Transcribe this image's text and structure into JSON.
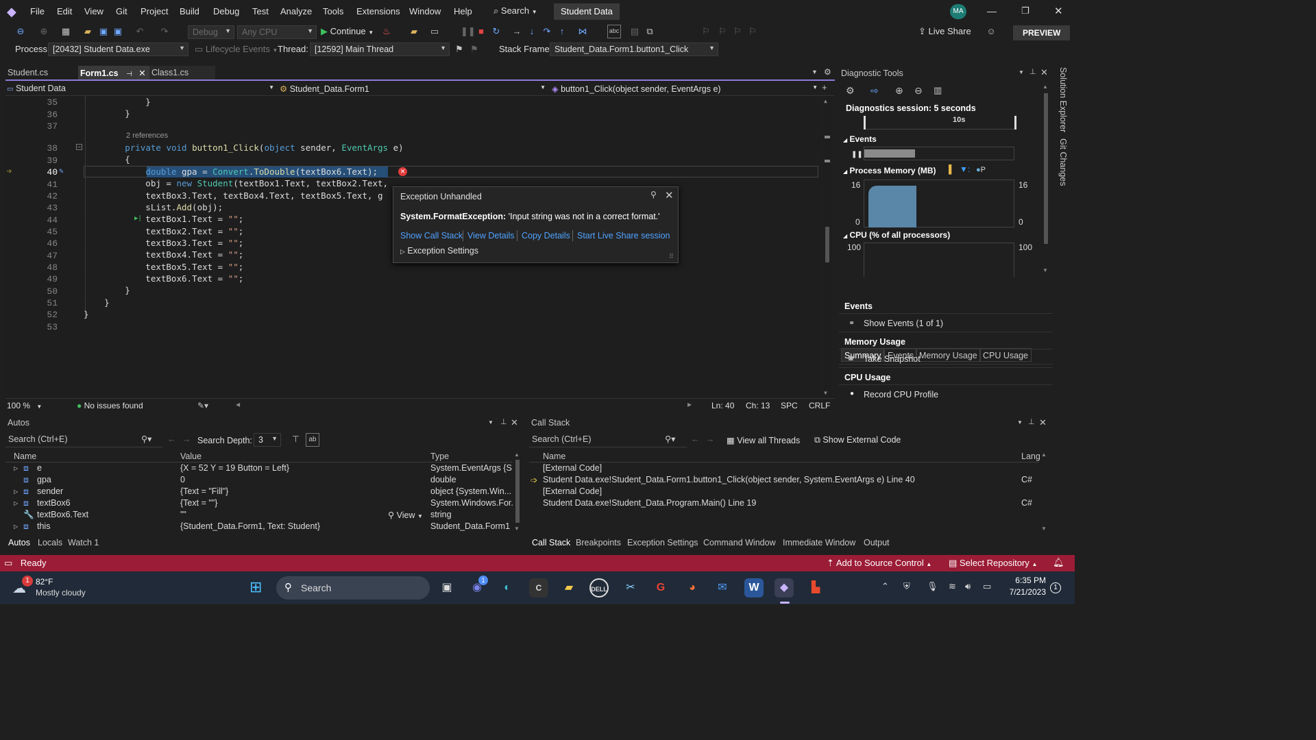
{
  "menu": {
    "items": [
      "File",
      "Edit",
      "View",
      "Git",
      "Project",
      "Build",
      "Debug",
      "Test",
      "Analyze",
      "Tools",
      "Extensions",
      "Window",
      "Help"
    ],
    "search_label": "Search",
    "solution_name": "Student Data",
    "avatar": "MA",
    "preview_label": "PREVIEW",
    "live_share_label": "Live Share"
  },
  "toolbar": {
    "config": "Debug",
    "platform": "Any CPU",
    "continue_label": "Continue"
  },
  "debugbar": {
    "process_label": "Process:",
    "process_value": "[20432] Student Data.exe",
    "lifecycle_label": "Lifecycle Events",
    "thread_label": "Thread:",
    "thread_value": "[12592] Main Thread",
    "stackframe_label": "Stack Frame:",
    "stackframe_value": "Student_Data.Form1.button1_Click"
  },
  "tabs": [
    "Student.cs",
    "Form1.cs",
    "Class1.cs"
  ],
  "navbar": {
    "project": "Student Data",
    "class": "Student_Data.Form1",
    "member": "button1_Click(object sender, EventArgs e)"
  },
  "editor": {
    "references": "2 references",
    "lines": [
      {
        "n": "35",
        "t": "            }"
      },
      {
        "n": "36",
        "t": "        }"
      },
      {
        "n": "37",
        "t": ""
      },
      {
        "n": "38",
        "t": "        private void button1_Click(object sender, EventArgs e)"
      },
      {
        "n": "39",
        "t": "        {"
      },
      {
        "n": "40",
        "t": "            double gpa = Convert.ToDouble(textBox6.Text);"
      },
      {
        "n": "41",
        "t": "            obj = new Student(textBox1.Text, textBox2.Text,"
      },
      {
        "n": "42",
        "t": "            textBox3.Text, textBox4.Text, textBox5.Text, g"
      },
      {
        "n": "43",
        "t": "            sList.Add(obj);"
      },
      {
        "n": "44",
        "t": "            textBox1.Text = \"\";"
      },
      {
        "n": "45",
        "t": "            textBox2.Text = \"\";"
      },
      {
        "n": "46",
        "t": "            textBox3.Text = \"\";"
      },
      {
        "n": "47",
        "t": "            textBox4.Text = \"\";"
      },
      {
        "n": "48",
        "t": "            textBox5.Text = \"\";"
      },
      {
        "n": "49",
        "t": "            textBox6.Text = \"\";"
      },
      {
        "n": "50",
        "t": "        }"
      },
      {
        "n": "51",
        "t": "    }"
      },
      {
        "n": "52",
        "t": "}"
      },
      {
        "n": "53",
        "t": ""
      }
    ]
  },
  "exception": {
    "title": "Exception Unhandled",
    "type": "System.FormatException:",
    "message": "'Input string was not in a correct format.'",
    "links": [
      "Show Call Stack",
      "View Details",
      "Copy Details",
      "Start Live Share session"
    ],
    "settings": "Exception Settings"
  },
  "editor_status": {
    "zoom": "100 %",
    "issues": "No issues found",
    "ln": "Ln: 40",
    "ch": "Ch: 13",
    "spc": "SPC",
    "crlf": "CRLF"
  },
  "diagnostics": {
    "title": "Diagnostic Tools",
    "session": "Diagnostics session: 5 seconds",
    "timeline_label": "10s",
    "events_label": "Events",
    "memory_label": "Process Memory (MB)",
    "memory_legend_p": "P",
    "mem_max": "16",
    "mem_min": "0",
    "cpu_label": "CPU (% of all processors)",
    "cpu_max": "100",
    "tabs": [
      "Summary",
      "Events",
      "Memory Usage",
      "CPU Usage"
    ],
    "sections": [
      {
        "title": "Events",
        "item": "Show Events (1 of 1)"
      },
      {
        "title": "Memory Usage",
        "item": "Take Snapshot"
      },
      {
        "title": "CPU Usage",
        "item": "Record CPU Profile"
      }
    ]
  },
  "sidebar": [
    "Solution Explorer",
    "Git Changes"
  ],
  "autos": {
    "title": "Autos",
    "search_placeholder": "Search (Ctrl+E)",
    "depth_label": "Search Depth:",
    "depth_value": "3",
    "columns": [
      "Name",
      "Value",
      "Type"
    ],
    "rows": [
      {
        "name": "e",
        "value": "{X = 52 Y = 19 Button = Left}",
        "type": "System.EventArgs {S..."
      },
      {
        "name": "gpa",
        "value": "0",
        "type": "double"
      },
      {
        "name": "sender",
        "value": "{Text = \"Fill\"}",
        "type": "object {System.Win..."
      },
      {
        "name": "textBox6",
        "value": "{Text = \"\"}",
        "type": "System.Windows.For..."
      },
      {
        "name": "textBox6.Text",
        "value": "\"\"",
        "type": "string"
      },
      {
        "name": "this",
        "value": "{Student_Data.Form1, Text: Student}",
        "type": "Student_Data.Form1"
      }
    ],
    "view_label": "View",
    "bottom_tabs": [
      "Autos",
      "Locals",
      "Watch 1"
    ]
  },
  "callstack": {
    "title": "Call Stack",
    "search_placeholder": "Search (Ctrl+E)",
    "view_threads": "View all Threads",
    "external_code": "Show External Code",
    "columns": [
      "Name",
      "Lang"
    ],
    "rows": [
      {
        "name": "[External Code]",
        "lang": ""
      },
      {
        "name": "Student Data.exe!Student_Data.Form1.button1_Click(object sender, System.EventArgs e) Line 40",
        "lang": "C#"
      },
      {
        "name": "[External Code]",
        "lang": ""
      },
      {
        "name": "Student Data.exe!Student_Data.Program.Main() Line 19",
        "lang": "C#"
      }
    ],
    "bottom_tabs": [
      "Call Stack",
      "Breakpoints",
      "Exception Settings",
      "Command Window",
      "Immediate Window",
      "Output"
    ]
  },
  "status": {
    "ready": "Ready",
    "source_control": "Add to Source Control",
    "repository": "Select Repository"
  },
  "taskbar": {
    "weather_temp": "82°F",
    "weather_desc": "Mostly cloudy",
    "weather_badge": "1",
    "search_label": "Search",
    "chat_badge": "1",
    "time": "6:35 PM",
    "date": "7/21/2023",
    "notif_badge": "1"
  }
}
